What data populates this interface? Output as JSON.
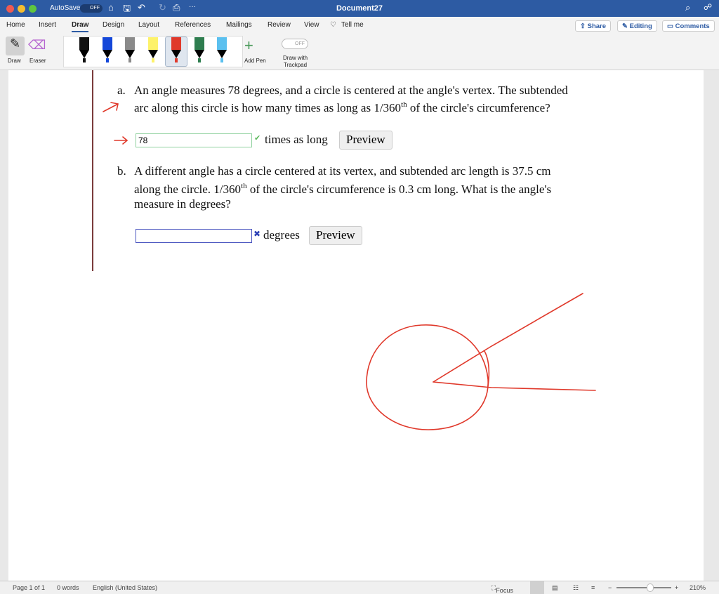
{
  "window": {
    "title": "Document27",
    "autosave_label": "AutoSave",
    "autosave_state": "OFF"
  },
  "tabs": [
    "Home",
    "Insert",
    "Draw",
    "Design",
    "Layout",
    "References",
    "Mailings",
    "Review",
    "View",
    "Tell me"
  ],
  "actions": {
    "share": "Share",
    "editing": "Editing",
    "comments": "Comments"
  },
  "ribbon": {
    "draw": "Draw",
    "eraser": "Eraser",
    "add_pen": "Add Pen",
    "trackpad_toggle": "OFF",
    "trackpad_label1": "Draw with",
    "trackpad_label2": "Trackpad",
    "pens": [
      {
        "color": "#111111"
      },
      {
        "color": "#1447d9"
      },
      {
        "color": "#8a8a8a"
      },
      {
        "color": "#fdf26a"
      },
      {
        "color": "#e0392b"
      },
      {
        "color": "#2e7d4f"
      },
      {
        "color": "#5bc0ef"
      }
    ]
  },
  "doc": {
    "a_label": "a.",
    "a_line1": "An angle measures 78 degrees, and a circle is centered at the angle's vertex. The subtended",
    "a_line2_pre": "arc along this circle is how many times as long as 1/360",
    "a_sup": "th",
    "a_line2_post": " of the circle's circumference?",
    "a_answer": "78",
    "a_unit": "times as long",
    "a_status": "correct",
    "b_label": "b.",
    "b_line1": "A different angle has a circle centered at its vertex, and subtended arc length is 37.5 cm",
    "b_line2_pre": "along the circle. 1/360",
    "b_sup": "th",
    "b_line2_post": " of the circle's circumference is 0.3 cm long. What is the angle's",
    "b_line3": "measure in degrees?",
    "b_answer": "",
    "b_unit": "degrees",
    "b_status": "incorrect",
    "preview": "Preview"
  },
  "status": {
    "page": "Page 1 of 1",
    "words": "0 words",
    "language": "English (United States)",
    "focus": "Focus",
    "zoom": "210%",
    "zoom_level_percent": 210
  },
  "colors": {
    "ink": "#e0392b",
    "titlebar": "#2d5ba3",
    "correct": "#5cb85c",
    "incorrect": "#2a3fb5"
  }
}
